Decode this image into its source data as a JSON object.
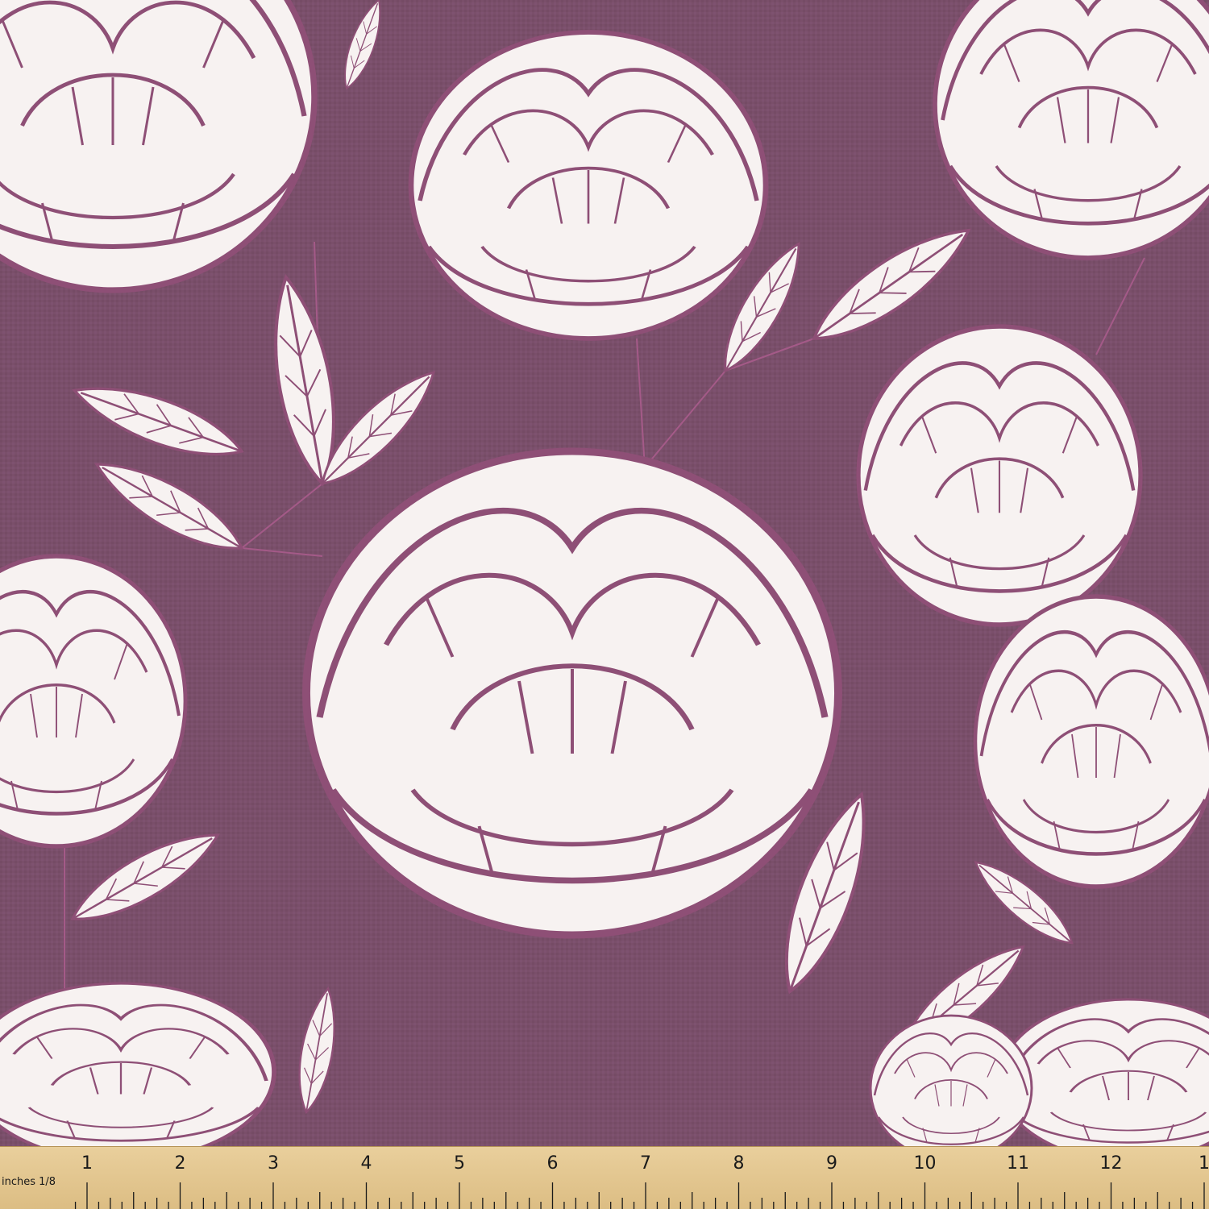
{
  "colors": {
    "background": "#7a4f6a",
    "petal_fill": "#f7f2f1",
    "line": "#8e4f76",
    "ruler": "#e3c68e",
    "ruler_ink": "#1a1a1a"
  },
  "ruler": {
    "unit_label": "inches 1/8",
    "numbers": [
      "1",
      "2",
      "3",
      "4",
      "5",
      "6",
      "7",
      "8",
      "9",
      "10",
      "11",
      "12",
      "1"
    ]
  }
}
